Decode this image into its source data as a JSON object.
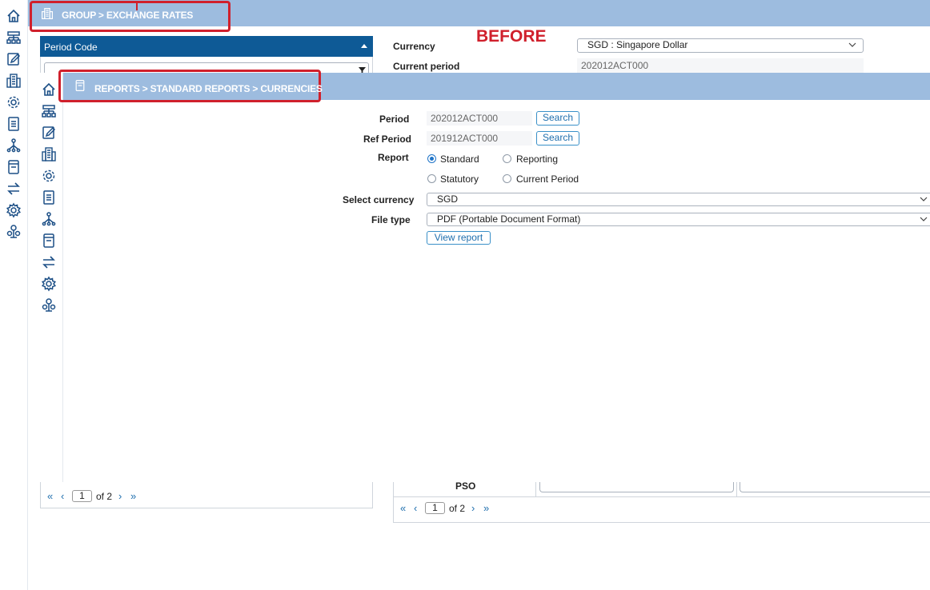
{
  "back_view": {
    "breadcrumb": "GROUP > EXCHANGE RATES",
    "overlay_label": "BEFORE",
    "period_panel": {
      "header": "Period Code",
      "filter_placeholder": "",
      "pager": {
        "current_page": "1",
        "of_text": "of 2"
      }
    },
    "currency_label": "Currency",
    "currency_value": "SGD : Singapore Dollar",
    "current_period_label": "Current period",
    "current_period_value": "202012ACT000",
    "table_partial": {
      "row_label": "PSO",
      "pager": {
        "current_page": "1",
        "of_text": "of 2"
      }
    }
  },
  "front_view": {
    "breadcrumb": "REPORTS > STANDARD REPORTS > CURRENCIES",
    "form": {
      "period_label": "Period",
      "period_value": "202012ACT000",
      "period_search": "Search",
      "ref_period_label": "Ref Period",
      "ref_period_value": "201912ACT000",
      "ref_period_search": "Search",
      "report_label": "Report",
      "report_options": [
        "Standard",
        "Reporting",
        "Statutory",
        "Current Period"
      ],
      "report_selected": "Standard",
      "select_currency_label": "Select currency",
      "select_currency_value": "SGD",
      "file_type_label": "File type",
      "file_type_value": "PDF (Portable Document Format)",
      "view_report_button": "View report"
    }
  },
  "icons": [
    "home-icon",
    "hierarchy-icon",
    "edit-icon",
    "building-icon",
    "gear-network-icon",
    "document-icon",
    "org-tree-icon",
    "book-icon",
    "swap-icon",
    "settings-icon",
    "people-icon"
  ],
  "colors": {
    "header_bar": "#9dbcdf",
    "panel_header": "#0e5a96",
    "highlight": "#d0202c",
    "before_text": "#d0202c",
    "accent": "#1f74c8"
  }
}
